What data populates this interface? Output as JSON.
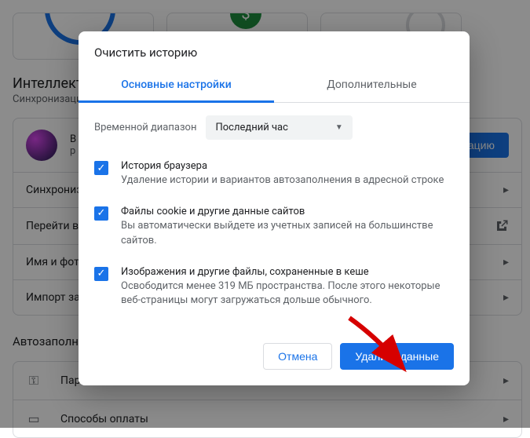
{
  "background": {
    "section1_title": "Интеллектуальные функции",
    "section1_sub": "Синхронизация",
    "profile_name": "В",
    "profile_sub": "р",
    "sync_button": "изацию",
    "rows": [
      {
        "label": "Синхрониз"
      },
      {
        "label": "Перейти в"
      },
      {
        "label": "Имя и фот"
      },
      {
        "label": "Импорт за"
      }
    ],
    "section2_title": "Автозаполне",
    "section2_rows": [
      {
        "icon": "key",
        "label": "Пар"
      },
      {
        "icon": "card",
        "label": "Способы оплаты"
      }
    ]
  },
  "dialog": {
    "title": "Очистить историю",
    "tabs": {
      "basic": "Основные настройки",
      "advanced": "Дополнительные"
    },
    "range_label": "Временной диапазон",
    "range_value": "Последний час",
    "options": [
      {
        "title": "История браузера",
        "desc": "Удаление истории и вариантов автозаполнения в адресной строке"
      },
      {
        "title": "Файлы cookie и другие данные сайтов",
        "desc": "Вы автоматически выйдете из учетных записей на большинстве сайтов."
      },
      {
        "title": "Изображения и другие файлы, сохраненные в кеше",
        "desc": "Освободится менее 319 МБ пространства. После этого некоторые веб-страницы могут загружаться дольше обычного."
      }
    ],
    "cancel": "Отмена",
    "confirm": "Удалить данные"
  }
}
